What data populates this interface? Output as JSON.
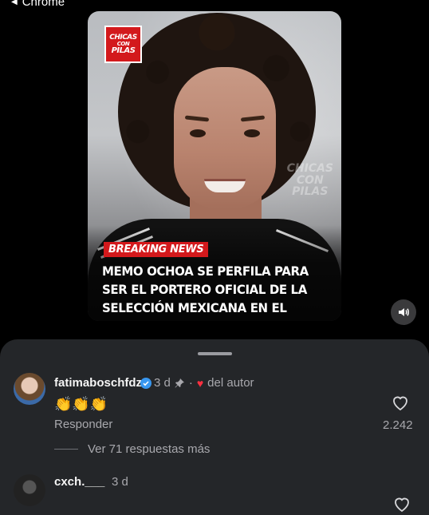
{
  "status": {
    "back_label": "Chrome"
  },
  "post": {
    "logo_lines": [
      "CHICAS",
      "CON",
      "PILAS"
    ],
    "watermark": [
      "CHICAS",
      "CON",
      "PILAS"
    ],
    "badge": "BREAKING NEWS",
    "headline": "MEMO OCHOA SE PERFILA PARA SER EL PORTERO OFICIAL DE LA SELECCIÓN MEXICANA EN EL MUNDIAL",
    "sound_icon": "speaker-icon"
  },
  "comments": [
    {
      "username": "fatimaboschfdz",
      "verified": true,
      "age": "3 d",
      "pinned": true,
      "author_like_label": "del autor",
      "text": "👏👏👏",
      "reply_label": "Responder",
      "likes": "2.242",
      "more_replies": "Ver 71 respuestas más"
    },
    {
      "username": "cxch.___",
      "age": "3 d"
    }
  ],
  "colors": {
    "sheet_bg": "#242629",
    "heart": "#ff3040",
    "verified": "#3897f0",
    "brand_red": "#d3191c"
  }
}
